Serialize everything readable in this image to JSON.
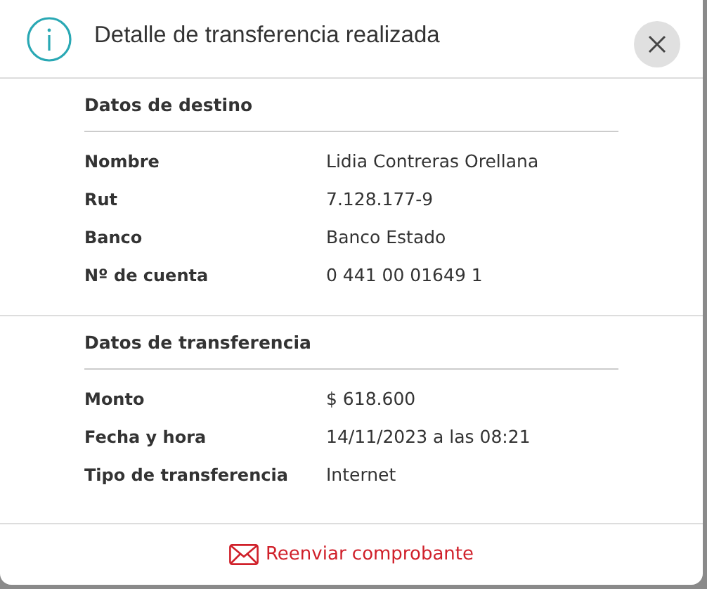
{
  "dialog": {
    "title": "Detalle de transferencia realizada",
    "sections": [
      {
        "title": "Datos de destino",
        "rows": [
          {
            "label": "Nombre",
            "value": "Lidia Contreras Orellana"
          },
          {
            "label": "Rut",
            "value": "7.128.177-9"
          },
          {
            "label": "Banco",
            "value": "Banco Estado"
          },
          {
            "label": "Nº de cuenta",
            "value": "0 441 00 01649 1"
          }
        ]
      },
      {
        "title": "Datos de transferencia",
        "rows": [
          {
            "label": "Monto",
            "value": "$ 618.600"
          },
          {
            "label": "Fecha y hora",
            "value": "14/11/2023 a las 08:21"
          },
          {
            "label": "Tipo de transferencia",
            "value": "Internet"
          }
        ]
      }
    ],
    "footer_link": "Reenviar comprobante"
  }
}
